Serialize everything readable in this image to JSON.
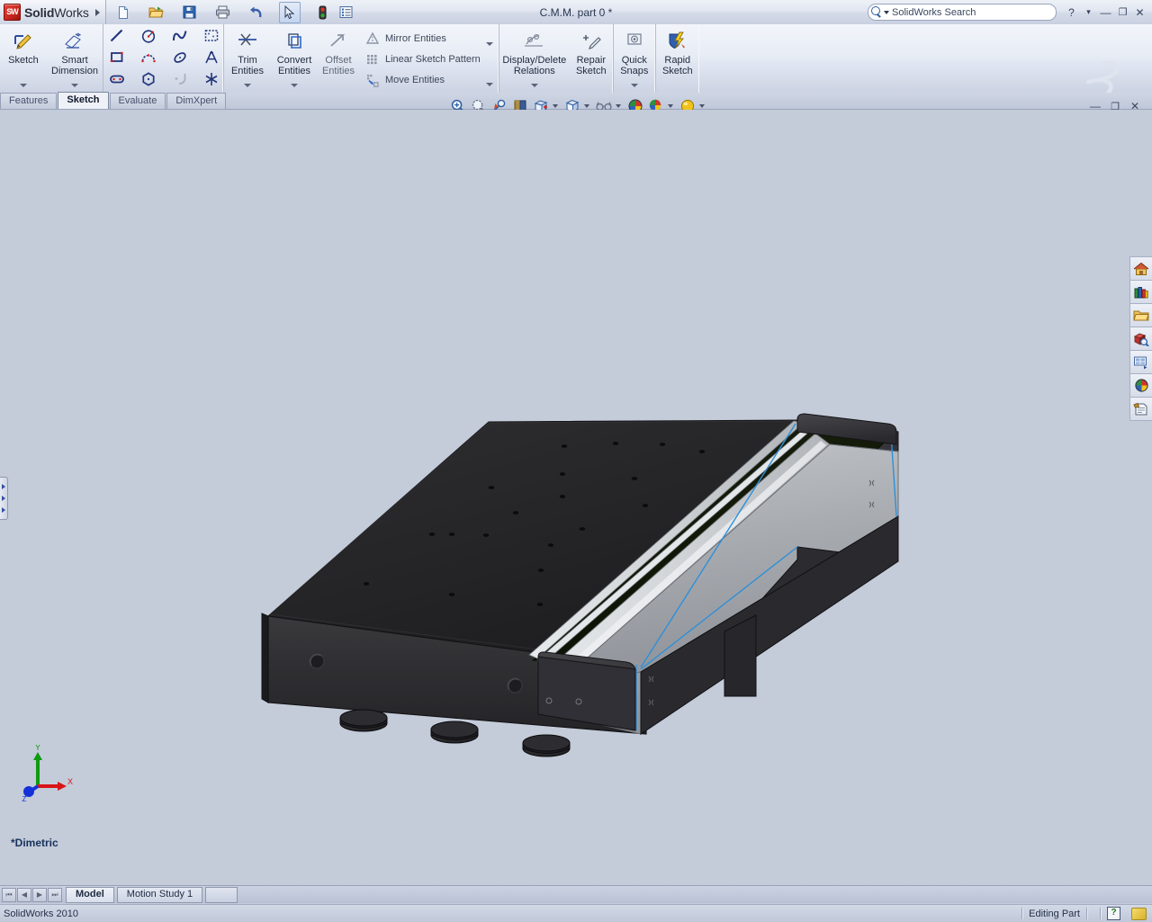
{
  "app": {
    "brand_bold": "Solid",
    "brand_light": "Works",
    "document_title": "C.M.M. part 0 *",
    "version_status": "SolidWorks 2010",
    "ds_watermark": "3DS"
  },
  "titlebar": {
    "quick_access": [
      {
        "name": "new-document",
        "icon": "new-doc-icon",
        "has_dropdown": true
      },
      {
        "name": "open-document",
        "icon": "open-folder-icon",
        "has_dropdown": true
      },
      {
        "name": "save-document",
        "icon": "floppy-save-icon",
        "has_dropdown": true
      },
      {
        "name": "print-document",
        "icon": "printer-icon",
        "has_dropdown": true
      },
      {
        "name": "undo",
        "icon": "undo-arrow-icon",
        "has_dropdown": true
      },
      {
        "name": "select",
        "icon": "cursor-arrow-icon",
        "has_dropdown": true,
        "selected": true
      },
      {
        "name": "rebuild",
        "icon": "traffic-light-icon",
        "has_dropdown": false
      },
      {
        "name": "options",
        "icon": "options-list-icon",
        "has_dropdown": true
      }
    ],
    "search": {
      "placeholder": "SolidWorks Search",
      "value": "SolidWorks Search",
      "icon": "search-magnifier-icon"
    },
    "window_controls": [
      {
        "name": "help",
        "label": "?"
      },
      {
        "name": "help-dropdown",
        "label": "▾"
      },
      {
        "name": "minimize",
        "label": "—"
      },
      {
        "name": "restore",
        "label": "❐"
      },
      {
        "name": "close",
        "label": "✕"
      }
    ]
  },
  "ribbon": {
    "groups": [
      {
        "name": "sketch-group",
        "big_buttons": [
          {
            "label_line1": "Sketch",
            "label_line2": "",
            "icon": "sketch-pencil-icon",
            "dropdown": true
          },
          {
            "label_line1": "Smart",
            "label_line2": "Dimension",
            "icon": "smart-dimension-icon",
            "dropdown": true
          }
        ]
      },
      {
        "name": "sketch-entities-group",
        "tools": [
          {
            "name": "line-tool",
            "icon": "line-icon",
            "dropdown": true
          },
          {
            "name": "circle-tool",
            "icon": "circle-icon",
            "dropdown": true
          },
          {
            "name": "spline-tool",
            "icon": "spline-icon",
            "dropdown": true
          },
          {
            "name": "sketch-fillet-area",
            "icon": "dashed-box-icon",
            "dropdown": false
          },
          {
            "name": "rectangle-tool",
            "icon": "rectangle-icon",
            "dropdown": true
          },
          {
            "name": "arc-3point-tool",
            "icon": "three-point-arc-icon",
            "dropdown": true
          },
          {
            "name": "ellipse-tool",
            "icon": "ellipse-icon",
            "dropdown": true
          },
          {
            "name": "text-tool",
            "icon": "text-a-icon",
            "dropdown": false
          },
          {
            "name": "slot-tool",
            "icon": "slot-icon",
            "dropdown": true
          },
          {
            "name": "polygon-tool",
            "icon": "polygon-icon",
            "dropdown": false
          },
          {
            "name": "sketch-fillet-tool",
            "icon": "sketch-fillet-icon",
            "dropdown": true,
            "disabled": true
          },
          {
            "name": "point-tool",
            "icon": "point-star-icon",
            "dropdown": false
          }
        ]
      },
      {
        "name": "edit-tools-group",
        "big_buttons": [
          {
            "label_line1": "Trim",
            "label_line2": "Entities",
            "icon": "trim-entities-icon",
            "dropdown": true
          },
          {
            "label_line1": "Convert",
            "label_line2": "Entities",
            "icon": "convert-entities-icon",
            "dropdown": true
          },
          {
            "label_line1": "Offset",
            "label_line2": "Entities",
            "icon": "offset-entities-icon",
            "dropdown": false
          }
        ],
        "text_items": [
          {
            "label": "Mirror Entities",
            "icon": "mirror-entities-icon",
            "dropdown": false
          },
          {
            "label": "Linear Sketch Pattern",
            "icon": "linear-pattern-icon",
            "dropdown": true
          },
          {
            "label": "Move Entities",
            "icon": "move-entities-icon",
            "dropdown": true
          }
        ]
      },
      {
        "name": "relations-group",
        "big_buttons": [
          {
            "label_line1": "Display/Delete",
            "label_line2": "Relations",
            "icon": "display-delete-relations-icon",
            "dropdown": true
          },
          {
            "label_line1": "Repair",
            "label_line2": "Sketch",
            "icon": "repair-sketch-icon",
            "dropdown": false
          }
        ]
      },
      {
        "name": "snaps-group",
        "big_buttons": [
          {
            "label_line1": "Quick",
            "label_line2": "Snaps",
            "icon": "quick-snaps-icon",
            "dropdown": true
          }
        ]
      },
      {
        "name": "rapid-sketch-group",
        "big_buttons": [
          {
            "label_line1": "Rapid",
            "label_line2": "Sketch",
            "icon": "rapid-sketch-icon",
            "dropdown": false
          }
        ]
      }
    ]
  },
  "command_tabs": {
    "items": [
      {
        "label": "Features",
        "active": false
      },
      {
        "label": "Sketch",
        "active": true
      },
      {
        "label": "Evaluate",
        "active": false
      },
      {
        "label": "DimXpert",
        "active": false
      }
    ]
  },
  "view_toolbar": {
    "buttons": [
      {
        "name": "zoom-to-fit",
        "icon": "zoom-fit-icon",
        "dropdown": false
      },
      {
        "name": "zoom-to-area",
        "icon": "zoom-area-icon",
        "dropdown": false
      },
      {
        "name": "previous-view",
        "icon": "previous-view-icon",
        "dropdown": false
      },
      {
        "name": "section-view",
        "icon": "section-view-icon",
        "dropdown": false
      },
      {
        "name": "view-orientation",
        "icon": "view-orientation-icon",
        "dropdown": true
      },
      {
        "name": "display-style",
        "icon": "display-style-cube-icon",
        "dropdown": true
      },
      {
        "name": "hide-show-items",
        "icon": "hide-show-glasses-icon",
        "dropdown": true
      },
      {
        "name": "edit-appearance",
        "icon": "appearance-sphere-icon",
        "dropdown": false
      },
      {
        "name": "apply-scene",
        "icon": "scene-sphere-icon",
        "dropdown": true
      },
      {
        "name": "view-settings",
        "icon": "view-settings-sphere-icon",
        "dropdown": true
      }
    ]
  },
  "document_window_controls": [
    {
      "name": "doc-minimize",
      "label": "—"
    },
    {
      "name": "doc-restore",
      "label": "❐"
    },
    {
      "name": "doc-close",
      "label": "✕"
    }
  ],
  "right_toolbar": {
    "buttons": [
      {
        "name": "solidworks-resources",
        "icon": "home-house-icon"
      },
      {
        "name": "design-library",
        "icon": "design-library-books-icon"
      },
      {
        "name": "file-explorer",
        "icon": "open-folder-icon"
      },
      {
        "name": "search-panel",
        "icon": "search-cube-icon"
      },
      {
        "name": "view-palette",
        "icon": "view-palette-icon"
      },
      {
        "name": "appearances-scenes",
        "icon": "appearance-sphere-icon"
      },
      {
        "name": "custom-properties",
        "icon": "custom-properties-icon"
      }
    ]
  },
  "viewport": {
    "view_name": "*Dimetric",
    "triad": {
      "x_label": "X",
      "y_label": "Y",
      "z_label": "Z",
      "x_color": "#d81515",
      "y_color": "#0f9b0f",
      "z_color": "#1430d8"
    },
    "background_color": "#c4cbd9",
    "model": {
      "name": "cmm-granite-table-assembly",
      "body_color": "#262628",
      "rail_color": "#a9adb1",
      "channel_color": "#121a0e",
      "highlight_edge_color": "#2f8fd8"
    }
  },
  "bottom_tabs": {
    "nav_buttons": [
      {
        "name": "first-tab",
        "label": "⏮"
      },
      {
        "name": "previous-tab",
        "label": "◀"
      },
      {
        "name": "next-tab",
        "label": "▶"
      },
      {
        "name": "last-tab",
        "label": "⏭"
      }
    ],
    "tabs": [
      {
        "label": "Model",
        "active": true
      },
      {
        "label": "Motion Study 1",
        "active": false
      }
    ]
  },
  "status_bar": {
    "left_text": "SolidWorks 2010",
    "edit_mode": "Editing Part",
    "help_badge": "?",
    "tag_icon": "tag-icon"
  }
}
